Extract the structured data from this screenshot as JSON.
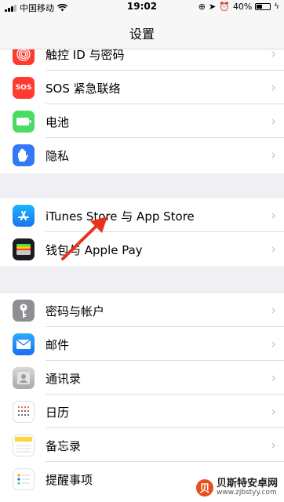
{
  "status_bar": {
    "carrier": "中国移动",
    "time": "19:02",
    "battery_percent": "40%",
    "battery_level": 0.4
  },
  "nav": {
    "title": "设置"
  },
  "groups": [
    {
      "rows": [
        {
          "label": "触控 ID 与密码",
          "icon": "fingerprint-icon",
          "color": "#ff3b30"
        },
        {
          "label": "SOS 紧急联络",
          "icon": "sos-icon",
          "color": "#ff3b30",
          "icon_text": "SOS"
        },
        {
          "label": "电池",
          "icon": "battery-icon",
          "color": "#4cd964"
        },
        {
          "label": "隐私",
          "icon": "hand-icon",
          "color": "#3478f6"
        }
      ]
    },
    {
      "rows": [
        {
          "label": "iTunes Store 与 App Store",
          "icon": "app-store-icon",
          "color": "#1a8cff"
        },
        {
          "label": "钱包与 Apple Pay",
          "icon": "wallet-icon",
          "color": "#1c1c1e"
        }
      ]
    },
    {
      "rows": [
        {
          "label": "密码与帐户",
          "icon": "key-icon",
          "color": "#8e8e93"
        },
        {
          "label": "邮件",
          "icon": "mail-icon",
          "color": "#1e90ff"
        },
        {
          "label": "通讯录",
          "icon": "contacts-icon",
          "color": "#bdbdbd"
        },
        {
          "label": "日历",
          "icon": "calendar-icon",
          "color": "#ffffff"
        },
        {
          "label": "备忘录",
          "icon": "notes-icon",
          "color": "#ffffff"
        },
        {
          "label": "提醒事项",
          "icon": "reminders-icon",
          "color": "#ffffff"
        }
      ]
    }
  ],
  "watermark": {
    "title": "贝斯特安卓网",
    "url": "www.zjbstyy.com",
    "logo": "贝"
  }
}
